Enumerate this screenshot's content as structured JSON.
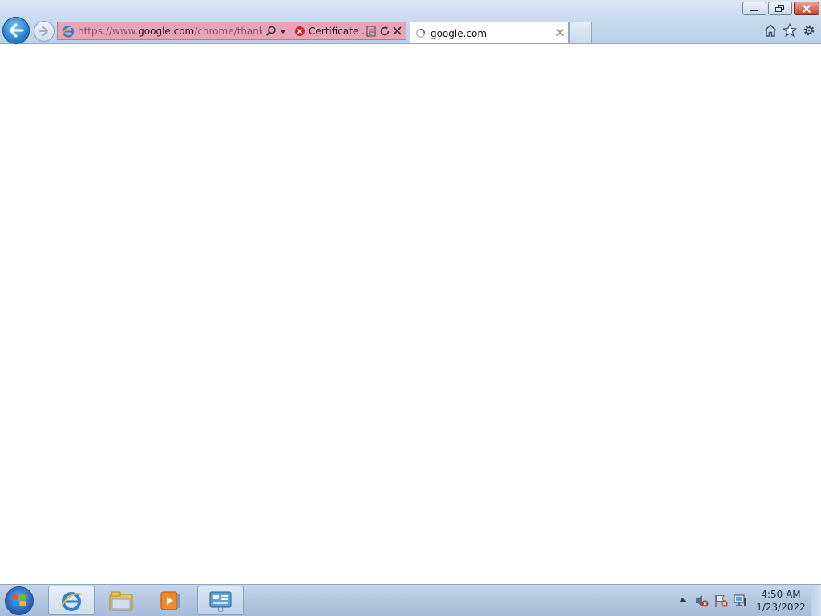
{
  "browser": {
    "address_bar": {
      "url_prefix": "https://www.",
      "url_domain": "google.com",
      "url_suffix": "/chrome/thank-yo",
      "certificate_label": "Certificate ..."
    },
    "tab": {
      "title": "google.com"
    },
    "colors": {
      "address_bar_error": "#e9a3b4",
      "back_button": "#2f86d3",
      "close_button": "#c7432a"
    },
    "icons": [
      "back-arrow-icon",
      "forward-arrow-icon",
      "ie-icon",
      "search-icon",
      "dropdown-arrow-icon",
      "certificate-error-icon",
      "compatibility-view-icon",
      "refresh-icon",
      "stop-icon",
      "loading-spinner-icon",
      "tab-close-icon",
      "home-icon",
      "favorites-star-icon",
      "tools-gear-icon"
    ]
  },
  "window_controls": [
    "minimize",
    "restore",
    "close"
  ],
  "taskbar": {
    "apps": [
      "internet-explorer",
      "windows-explorer",
      "media-player",
      "control-panel"
    ],
    "clock": {
      "time": "4:50 AM",
      "date": "1/23/2022"
    }
  }
}
